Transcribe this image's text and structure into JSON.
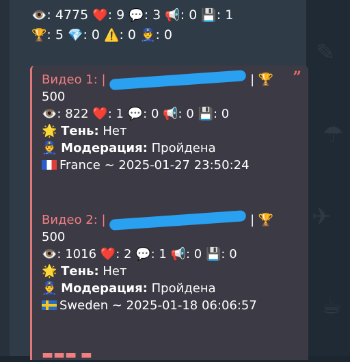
{
  "totals": {
    "views_icon": "eye-icon",
    "views": "4775",
    "likes_icon": "heart-icon",
    "likes": "9",
    "comments_icon": "speech-bubble-icon",
    "comments": "3",
    "shares_icon": "megaphone-icon",
    "shares": "0",
    "saves_icon": "floppy-disk-icon",
    "saves": "1",
    "trophies_icon": "trophy-icon",
    "trophies": "5",
    "gems_icon": "gem-icon",
    "gems": "0",
    "warnings_icon": "warning-icon",
    "warnings": "0",
    "moderators_icon": "police-officer-icon",
    "moderators": "0"
  },
  "videos": [
    {
      "title": "Видео 1: |",
      "score": "500",
      "views": "822",
      "likes": "1",
      "comments": "0",
      "shares": "0",
      "saves": "0",
      "shadow_label": "Тень:",
      "shadow_value": " Нет",
      "moderation_label": "Модерация:",
      "moderation_value": " Пройдена",
      "location": "France ~ 2025-01-27 23:50:24"
    },
    {
      "title": "Видео 2: |",
      "score": "500",
      "views": "1016",
      "likes": "2",
      "comments": "1",
      "shares": "0",
      "saves": "0",
      "shadow_label": "Тень:",
      "shadow_value": " Нет",
      "moderation_label": "Модерация:",
      "moderation_value": " Пройдена",
      "location": "Sweden ~ 2025-01-18 06:06:57"
    }
  ],
  "colors": {
    "accent": "#f07f82",
    "redaction": "#29a0f0",
    "bubble": "#2f3b46",
    "quote": "#3b3a45"
  }
}
